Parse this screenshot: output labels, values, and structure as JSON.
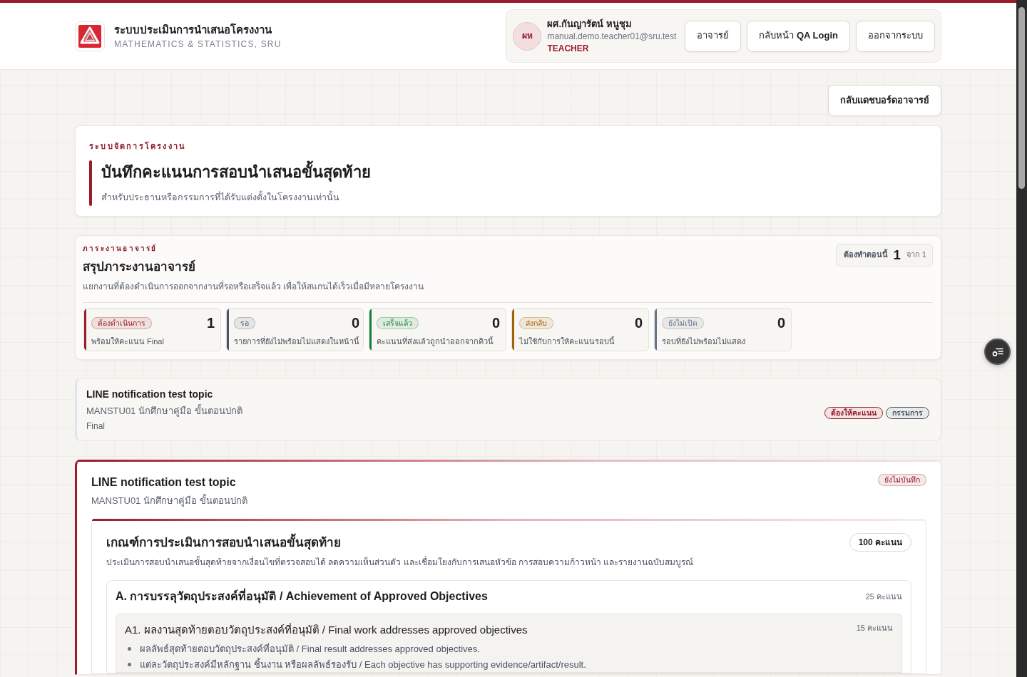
{
  "header": {
    "title": "ระบบประเมินการนำเสนอโครงงาน",
    "subtitle": "MATHEMATICS & STATISTICS, SRU",
    "user": {
      "initials": "ผห",
      "name": "ผศ.กันญารัตน์ หนูชุม",
      "email": "manual.demo.teacher01@sru.test",
      "role": "TEACHER"
    },
    "buttons": [
      {
        "label": "อาจารย์"
      },
      {
        "label": "กลับหน้า **QA Login**"
      },
      {
        "label": "ออกจากระบบ"
      }
    ]
  },
  "back_button": "กลับแดชบอร์ดอาจารย์",
  "hero": {
    "eyebrow": "ระบบจัดการโครงงาน",
    "title": "บันทึกคะแนนการสอบนำเสนอขั้นสุดท้าย",
    "subtitle": "สำหรับประธานหรือกรรมการที่ได้รับแต่งตั้งในโครงงานเท่านั้น"
  },
  "workload": {
    "eyebrow": "ภาระงานอาจารย์",
    "title": "สรุปภาระงานอาจารย์",
    "description": "แยกงานที่ต้องดำเนินการออกจากงานที่รอหรือเสร็จแล้ว เพื่อให้สแกนได้เร็วเมื่อมีหลายโครงงาน",
    "counter": {
      "label": "ต้องทำตอนนี้",
      "value": "1",
      "total": "จาก 1"
    },
    "stats": [
      {
        "label": "ต้องดำเนินการ",
        "count": "1",
        "caption": "พร้อมให้คะแนน Final",
        "color": "#9b1c2c"
      },
      {
        "label": "รอ",
        "count": "0",
        "caption": "รายการที่ยังไม่พร้อมไม่แสดงในหน้านี้",
        "color": "#475569"
      },
      {
        "label": "เสร็จแล้ว",
        "count": "0",
        "caption": "คะแนนที่ส่งแล้วถูกนำออกจากคิวนี้",
        "color": "#15803d"
      },
      {
        "label": "ส่งกลับ",
        "count": "0",
        "caption": "ไม่ใช้กับการให้คะแนนรอบนี้",
        "color": "#a16207"
      },
      {
        "label": "ยังไม่เปิด",
        "count": "0",
        "caption": "รอบที่ยังไม่พร้อมไม่แสดง",
        "color": "#64748b"
      }
    ]
  },
  "queue": [
    {
      "title": "LINE notification test topic",
      "subtitle": "MANSTU01 นักศึกษาคู่มือ ขั้นตอนปกติ",
      "round": "Final",
      "tags": [
        {
          "label": "ต้องให้คะแนน",
          "color": "#9b1c2c"
        },
        {
          "label": "กรรมการ",
          "color": "#475569"
        }
      ]
    }
  ],
  "scoring": {
    "title": "LINE notification test topic",
    "subtitle": "MANSTU01 นักศึกษาคู่มือ ขั้นตอนปกติ",
    "status": "ยังไม่บันทึก",
    "rubric": {
      "title": "เกณฑ์การประเมินการสอบนำเสนอขั้นสุดท้าย",
      "description": "ประเมินการสอบนำเสนอขั้นสุดท้ายจากเงื่อนไขที่ตรวจสอบได้ ลดความเห็นส่วนตัว และเชื่อมโยงกับการเสนอหัวข้อ การสอบความก้าวหน้า และรายงานฉบับสมบูรณ์",
      "total": "100 คะแนน",
      "sections": [
        {
          "title": "A. การบรรลุวัตถุประสงค์ที่อนุมัติ / Achievement of Approved Objectives",
          "points": "25 คะแนน",
          "items": [
            {
              "title": "A1. ผลงานสุดท้ายตอบวัตถุประสงค์ที่อนุมัติ / Final work addresses approved objectives",
              "points": "15 คะแนน",
              "criteria": [
                "ผลลัพธ์สุดท้ายตอบวัตถุประสงค์ที่อนุมัติ / Final result addresses approved objectives.",
                "แต่ละวัตถุประสงค์มีหลักฐาน ชิ้นงาน หรือผลลัพธ์รองรับ / Each objective has supporting evidence/artifact/result."
              ]
            }
          ]
        }
      ]
    }
  }
}
